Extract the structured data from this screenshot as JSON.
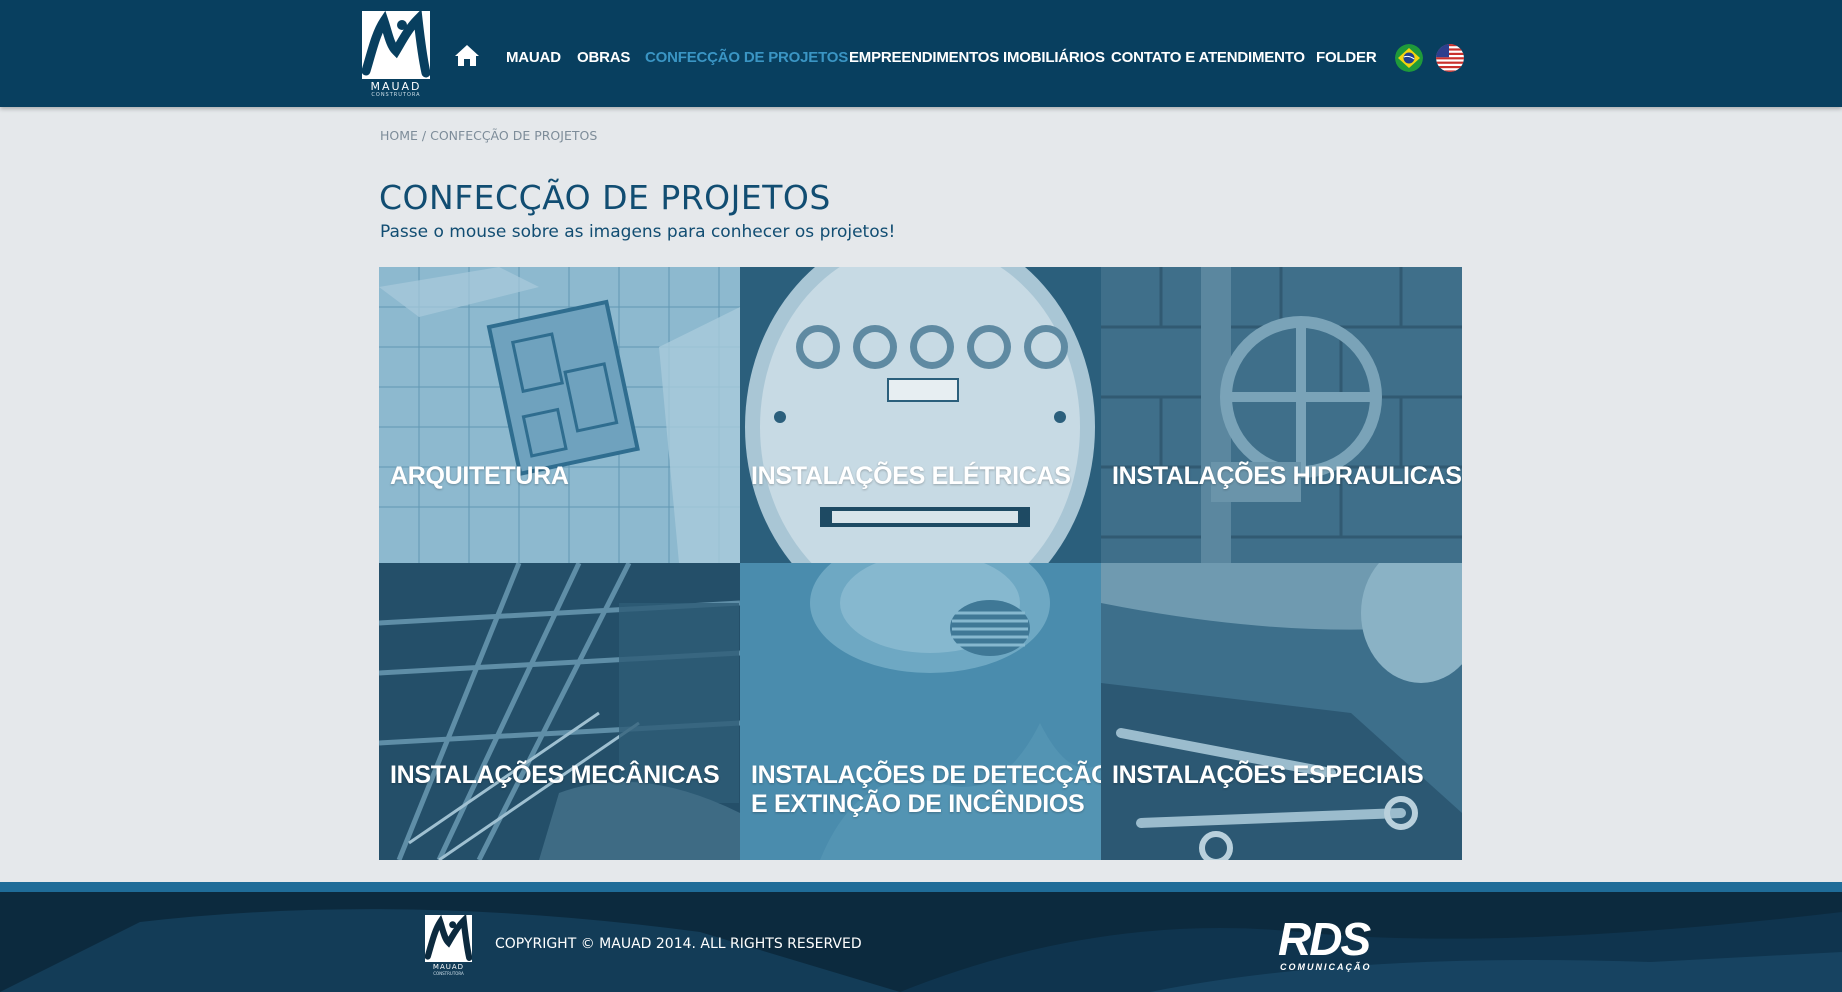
{
  "header": {
    "logo": {
      "word": "MAUAD",
      "sub": "CONSTRUTORA"
    },
    "nav": [
      {
        "label": "MAUAD"
      },
      {
        "label": "OBRAS"
      },
      {
        "label": "CONFECÇÃO DE PROJETOS",
        "active": true
      },
      {
        "label": "EMPREENDIMENTOS IMOBILIÁRIOS"
      },
      {
        "label": "CONTATO E ATENDIMENTO"
      },
      {
        "label": "FOLDER"
      }
    ],
    "icons": {
      "home": "home-icon",
      "flag_br": "brazil-flag-icon",
      "flag_us": "usa-flag-icon"
    }
  },
  "breadcrumb": {
    "home": "HOME",
    "separator": " / ",
    "current": "CONFECÇÃO DE PROJETOS"
  },
  "page": {
    "title": "CONFECÇÃO DE PROJETOS",
    "subtitle": "Passe o mouse sobre as imagens para conhecer os projetos!"
  },
  "tiles": [
    {
      "label": "ARQUITETURA"
    },
    {
      "label": "INSTALAÇÕES ELÉTRICAS"
    },
    {
      "label": "INSTALAÇÕES HIDRAULICAS"
    },
    {
      "label": "INSTALAÇÕES MECÂNICAS"
    },
    {
      "label_line1": "INSTALAÇÕES DE DETECÇÃO",
      "label_line2": "E EXTINÇÃO DE INCÊNDIOS"
    },
    {
      "label": "INSTALAÇÕES ESPECIAIS"
    }
  ],
  "footer": {
    "logo": {
      "word": "MAUAD",
      "sub": "CONSTRUTORA"
    },
    "copyright": "COPYRIGHT © MAUAD 2014. ALL RIGHTS RESERVED",
    "agency": {
      "word": "RDS",
      "sub": "COMUNICAÇÃO"
    }
  },
  "colors": {
    "header_bg": "#083f5f",
    "nav_active": "#3a95c4",
    "title": "#114d72",
    "tile_overlay": "#2e7ea3",
    "footer_bg": "#0c2a3e",
    "footer_bar": "#1f6c98"
  }
}
